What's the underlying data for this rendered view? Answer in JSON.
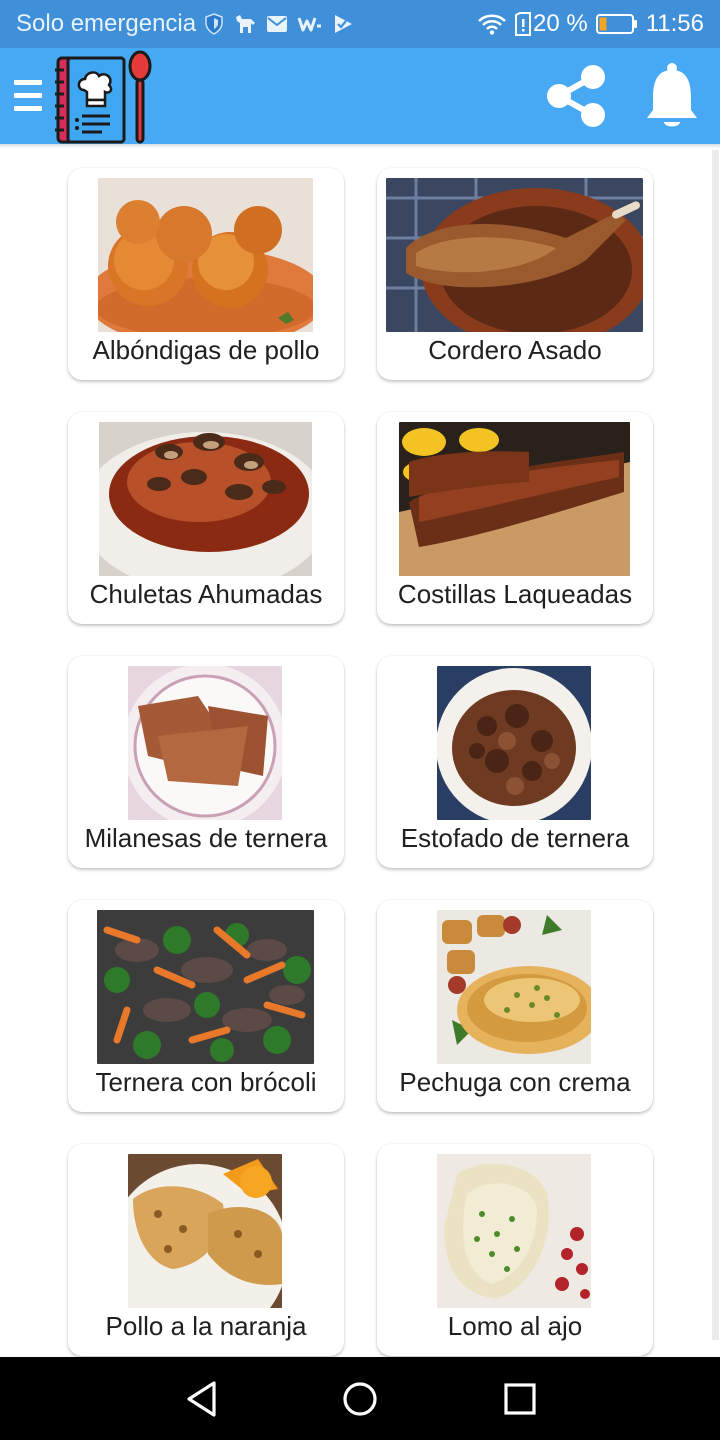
{
  "status_bar": {
    "carrier": "Solo emergencia",
    "battery": "20 %",
    "time": "11:56",
    "icons": [
      "shield-icon",
      "dog-icon",
      "mail-icon",
      "w-app-icon",
      "check-flag-icon",
      "wifi-icon",
      "sim-alert-icon",
      "battery-icon"
    ]
  },
  "app_bar": {
    "background": "#47a9f3",
    "icons": [
      "menu-icon",
      "recipe-book-logo",
      "share-icon",
      "bell-icon"
    ]
  },
  "recipes": [
    {
      "title": "Albóndigas de pollo"
    },
    {
      "title": "Cordero Asado"
    },
    {
      "title": "Chuletas Ahumadas"
    },
    {
      "title": "Costillas Laqueadas"
    },
    {
      "title": "Milanesas de ternera"
    },
    {
      "title": "Estofado de ternera"
    },
    {
      "title": "Ternera con brócoli"
    },
    {
      "title": "Pechuga con crema"
    },
    {
      "title": "Pollo a la naranja"
    },
    {
      "title": "Lomo al ajo"
    }
  ],
  "nav_bar": {
    "icons": [
      "back-icon",
      "home-icon",
      "recents-icon"
    ]
  }
}
